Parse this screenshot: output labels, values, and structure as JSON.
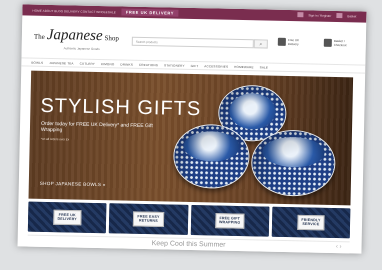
{
  "topbar": {
    "links": "HOME  ABOUT  BLOG  DELIVERY  CONTACT  WHOLESALE",
    "promo": "FREE UK DELIVERY",
    "account": "Sign in / Register",
    "basket": "Basket"
  },
  "header": {
    "logo_the": "The",
    "logo_japanese": "Japanese",
    "logo_shop": "Shop",
    "logo_tagline": "Authentic Japanese Goods",
    "search_placeholder": "Search products",
    "search_button": "⌕",
    "delivery_label": "Free UK Delivery",
    "basket_label": "Basket / Checkout"
  },
  "nav": {
    "items": [
      "BOWLS",
      "JAPANESE TEA",
      "CUTLERY",
      "KIMONO",
      "DRINKS",
      "CREATIONS",
      "STATIONERY",
      "GIFT",
      "ACCESSORIES",
      "HOMEWARE",
      "SALE"
    ]
  },
  "hero": {
    "title": "STYLISH GIFTS",
    "subtitle": "Order today for FREE UK Delivery* and FREE Gift Wrapping",
    "small_note": "*on all orders over £x",
    "cta": "SHOP JAPANESE BOWLS »"
  },
  "tiles": [
    {
      "label_line1": "FREE UK",
      "label_line2": "DELIVERY"
    },
    {
      "label_line1": "FREE EASY",
      "label_line2": "RETURNS"
    },
    {
      "label_line1": "FREE GIFT",
      "label_line2": "WRAPPING"
    },
    {
      "label_line1": "FRIENDLY",
      "label_line2": "SERVICE"
    }
  ],
  "banner": {
    "text": "Keep Cool this Summer",
    "arrows": "‹ ›"
  },
  "colors": {
    "topbar": "#7a2d4f",
    "hero_wood": "#6a4326",
    "tile_navy": "#1d2d4b",
    "bowl_blue": "#1e3f86"
  }
}
